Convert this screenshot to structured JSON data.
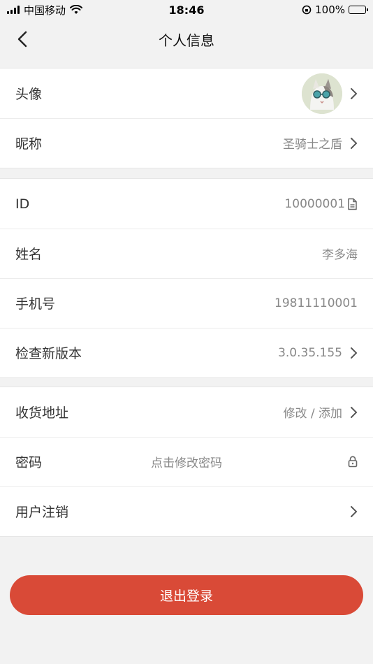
{
  "status_bar": {
    "carrier": "中国移动",
    "time": "18:46",
    "battery": "100%"
  },
  "nav": {
    "title": "个人信息"
  },
  "group1": {
    "avatar_label": "头像",
    "nickname_label": "昵称",
    "nickname_value": "圣骑士之盾"
  },
  "group2": {
    "id_label": "ID",
    "id_value": "10000001",
    "name_label": "姓名",
    "name_value": "李多海",
    "phone_label": "手机号",
    "phone_value": "19811110001",
    "version_label": "检查新版本",
    "version_value": "3.0.35.155"
  },
  "group3": {
    "address_label": "收货地址",
    "address_value": "修改 / 添加",
    "password_label": "密码",
    "password_hint": "点击修改密码",
    "cancel_label": "用户注销"
  },
  "logout_label": "退出登录",
  "colors": {
    "accent": "#d94a37",
    "background": "#f2f2f2"
  }
}
